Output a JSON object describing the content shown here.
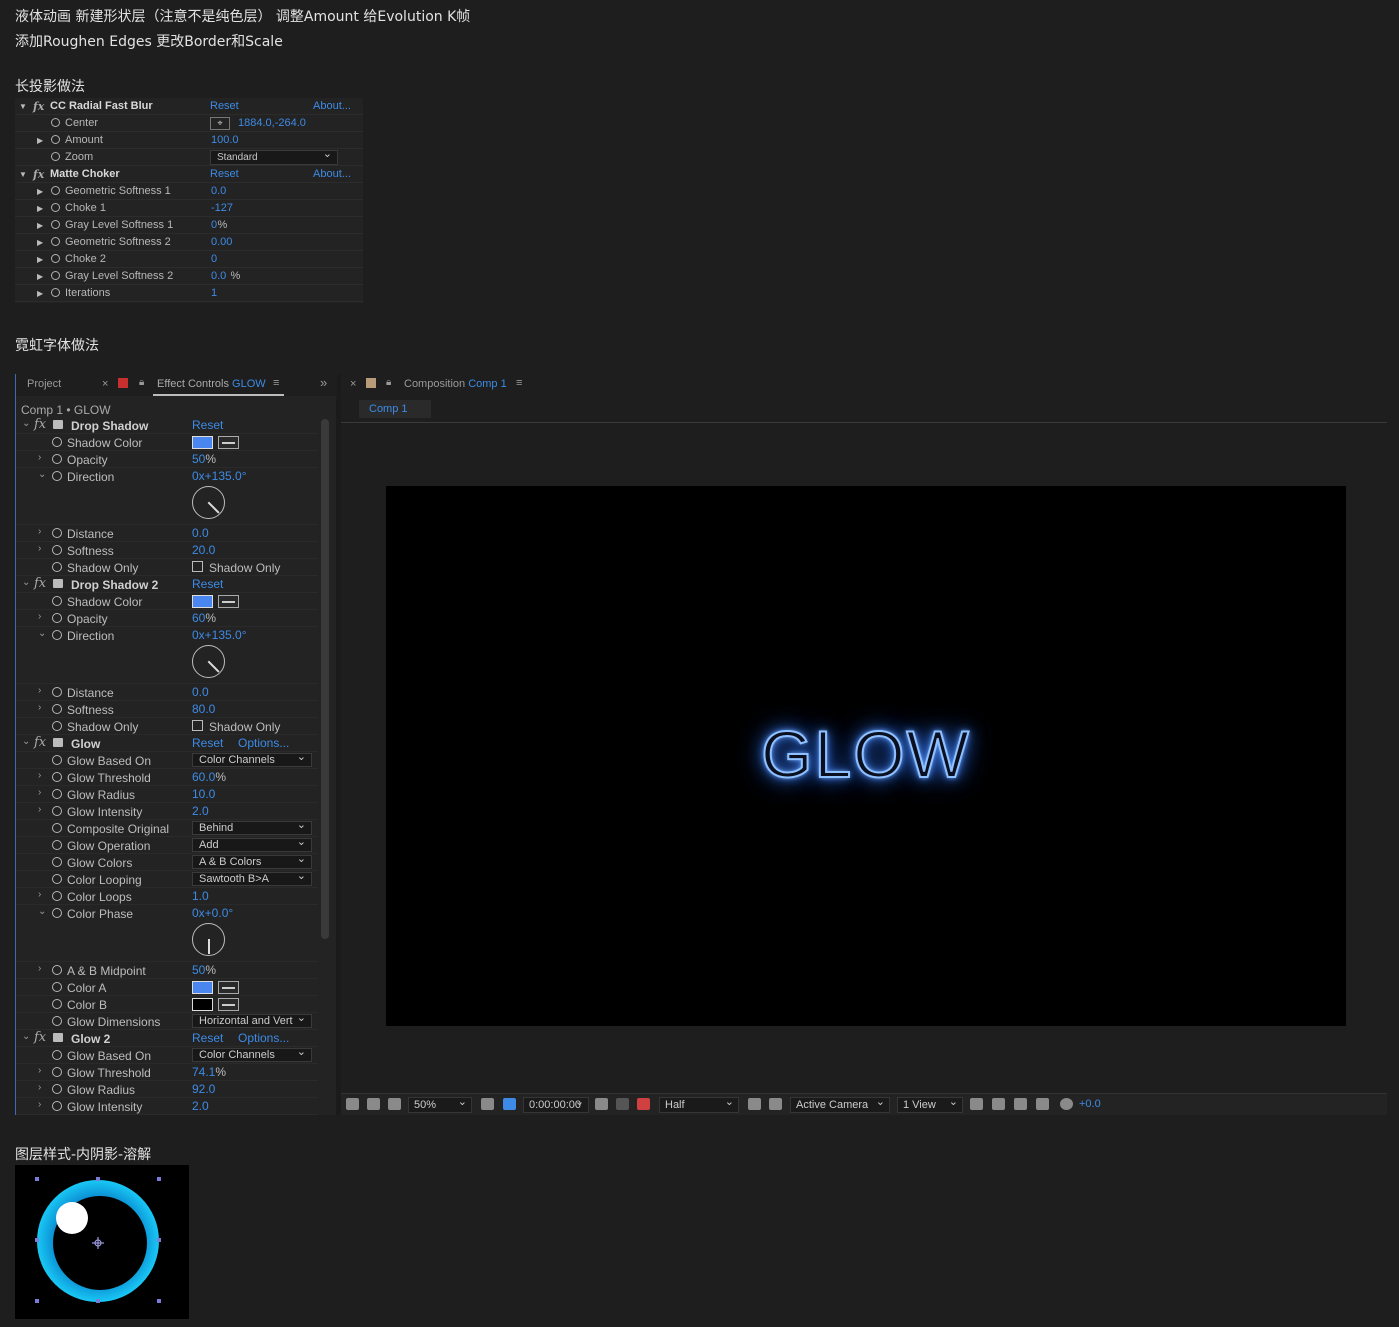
{
  "notes": {
    "line1": "液体动画 新建形状层（注意不是纯色层） 调整Amount 给Evolution K帧",
    "line2": "添加Roughen Edges 更改Border和Scale",
    "section_long_shadow": "长投影做法",
    "section_neon": "霓虹字体做法",
    "section_layer_style": "图层样式-内阴影-溶解"
  },
  "panel1": {
    "effects": [
      {
        "name": "CC Radial Fast Blur",
        "reset": "Reset",
        "about": "About...",
        "params": [
          {
            "name": "Center",
            "value": "1884.0,-264.0",
            "has_arrow": false,
            "has_target": true
          },
          {
            "name": "Amount",
            "value": "100.0",
            "has_arrow": true
          },
          {
            "name": "Zoom",
            "value": "Standard",
            "has_arrow": false,
            "dropdown": true
          }
        ]
      },
      {
        "name": "Matte Choker",
        "reset": "Reset",
        "about": "About...",
        "params": [
          {
            "name": "Geometric Softness 1",
            "value": "0.0",
            "has_arrow": true
          },
          {
            "name": "Choke 1",
            "value": "-127",
            "has_arrow": true
          },
          {
            "name": "Gray Level Softness 1",
            "value": "0",
            "unit": "%",
            "has_arrow": true
          },
          {
            "name": "Geometric Softness 2",
            "value": "0.00",
            "has_arrow": true
          },
          {
            "name": "Choke 2",
            "value": "0",
            "has_arrow": true
          },
          {
            "name": "Gray Level Softness 2",
            "value": "0.0",
            "unit": "%",
            "has_arrow": true
          },
          {
            "name": "Iterations",
            "value": "1",
            "has_arrow": true
          }
        ]
      }
    ]
  },
  "ae": {
    "tabs": {
      "project": "Project",
      "close": "×",
      "effect_controls_prefix": "Effect Controls",
      "effect_controls_layer": "GLOW",
      "menu": "≡",
      "expand": "»",
      "composition_prefix": "Composition",
      "composition_name": "Comp 1"
    },
    "comp_sub": "Comp 1 • GLOW",
    "comp_tab": "Comp 1",
    "viewer_text": "GLOW",
    "effects": [
      {
        "name": "Drop Shadow",
        "reset": "Reset",
        "options": "",
        "params": [
          {
            "type": "color",
            "name": "Shadow Color",
            "color": "#4a86f0"
          },
          {
            "type": "num",
            "name": "Opacity",
            "value": "50",
            "unit": "%"
          },
          {
            "type": "angle",
            "name": "Direction",
            "value": "0x+135.0°",
            "angle": 135
          },
          {
            "type": "num",
            "name": "Distance",
            "value": "0.0"
          },
          {
            "type": "num",
            "name": "Softness",
            "value": "20.0"
          },
          {
            "type": "check",
            "name": "Shadow Only",
            "label": "Shadow Only"
          }
        ]
      },
      {
        "name": "Drop Shadow 2",
        "reset": "Reset",
        "options": "",
        "params": [
          {
            "type": "color",
            "name": "Shadow Color",
            "color": "#4a86f0"
          },
          {
            "type": "num",
            "name": "Opacity",
            "value": "60",
            "unit": "%"
          },
          {
            "type": "angle",
            "name": "Direction",
            "value": "0x+135.0°",
            "angle": 135
          },
          {
            "type": "num",
            "name": "Distance",
            "value": "0.0"
          },
          {
            "type": "num",
            "name": "Softness",
            "value": "80.0"
          },
          {
            "type": "check",
            "name": "Shadow Only",
            "label": "Shadow Only"
          }
        ]
      },
      {
        "name": "Glow",
        "reset": "Reset",
        "options": "Options...",
        "params": [
          {
            "type": "dd",
            "name": "Glow Based On",
            "value": "Color Channels"
          },
          {
            "type": "num",
            "name": "Glow Threshold",
            "value": "60.0",
            "unit": "%"
          },
          {
            "type": "num",
            "name": "Glow Radius",
            "value": "10.0"
          },
          {
            "type": "num",
            "name": "Glow Intensity",
            "value": "2.0"
          },
          {
            "type": "dd",
            "name": "Composite Original",
            "value": "Behind"
          },
          {
            "type": "dd",
            "name": "Glow Operation",
            "value": "Add"
          },
          {
            "type": "dd",
            "name": "Glow Colors",
            "value": "A & B Colors"
          },
          {
            "type": "dd",
            "name": "Color Looping",
            "value": "Sawtooth B>A"
          },
          {
            "type": "num",
            "name": "Color Loops",
            "value": "1.0"
          },
          {
            "type": "angle",
            "name": "Color Phase",
            "value": "0x+0.0°",
            "angle": 180
          },
          {
            "type": "num",
            "name": "A & B Midpoint",
            "value": "50",
            "unit": "%"
          },
          {
            "type": "color",
            "name": "Color A",
            "color": "#4a86f0"
          },
          {
            "type": "color",
            "name": "Color B",
            "color": "#000000"
          },
          {
            "type": "dd",
            "name": "Glow Dimensions",
            "value": "Horizontal and Vert"
          }
        ]
      },
      {
        "name": "Glow 2",
        "reset": "Reset",
        "options": "Options...",
        "params": [
          {
            "type": "dd",
            "name": "Glow Based On",
            "value": "Color Channels"
          },
          {
            "type": "num",
            "name": "Glow Threshold",
            "value": "74.1",
            "unit": "%"
          },
          {
            "type": "num",
            "name": "Glow Radius",
            "value": "92.0"
          },
          {
            "type": "num",
            "name": "Glow Intensity",
            "value": "2.0"
          }
        ]
      }
    ],
    "bottom": {
      "zoom": "50%",
      "timecode": "0:00:00:00",
      "resolution": "Half",
      "camera": "Active Camera",
      "views": "1 View",
      "exposure": "+0.0"
    }
  }
}
